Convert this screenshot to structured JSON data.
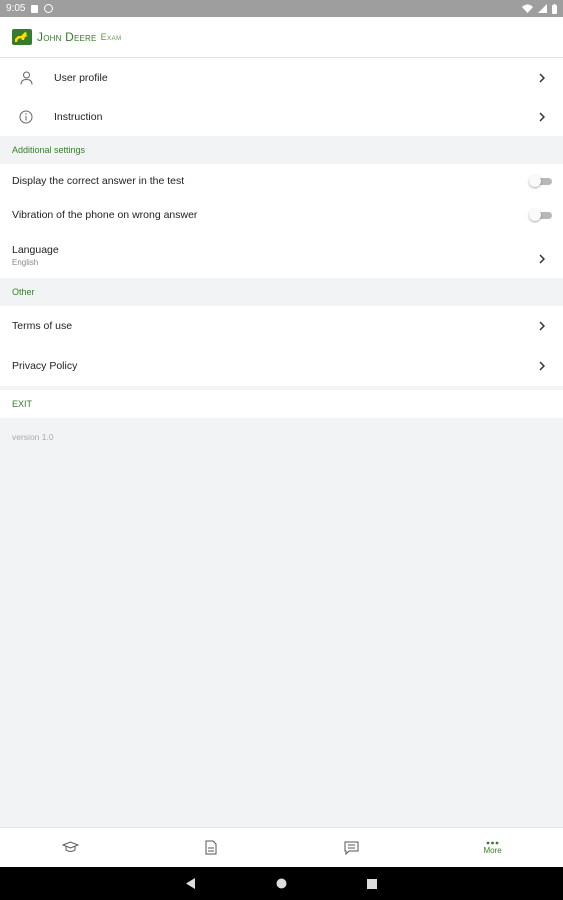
{
  "status_bar": {
    "time": "9:05"
  },
  "app": {
    "brand": "John Deere",
    "subtitle": "Exam",
    "brand_color": "#367c2b"
  },
  "menu": {
    "user_profile": "User profile",
    "instruction": "Instruction"
  },
  "sections": {
    "additional_settings": "Additional settings",
    "other": "Other"
  },
  "settings": {
    "show_correct_answer": {
      "label": "Display the correct answer in the test",
      "enabled": false
    },
    "vibration": {
      "label": "Vibration of the phone on wrong answer",
      "enabled": false
    },
    "language": {
      "label": "Language",
      "value": "English"
    }
  },
  "other": {
    "terms": "Terms of use",
    "privacy": "Privacy Policy"
  },
  "exit_label": "EXIT",
  "version": "version 1.0",
  "bottom_nav": {
    "items": [
      {
        "icon": "graduation-cap-icon"
      },
      {
        "icon": "document-icon"
      },
      {
        "icon": "message-icon"
      },
      {
        "icon": "more-dots-icon",
        "label": "More",
        "active": true
      }
    ]
  },
  "icons": {
    "user_profile": "user-icon",
    "instruction": "info-icon"
  }
}
